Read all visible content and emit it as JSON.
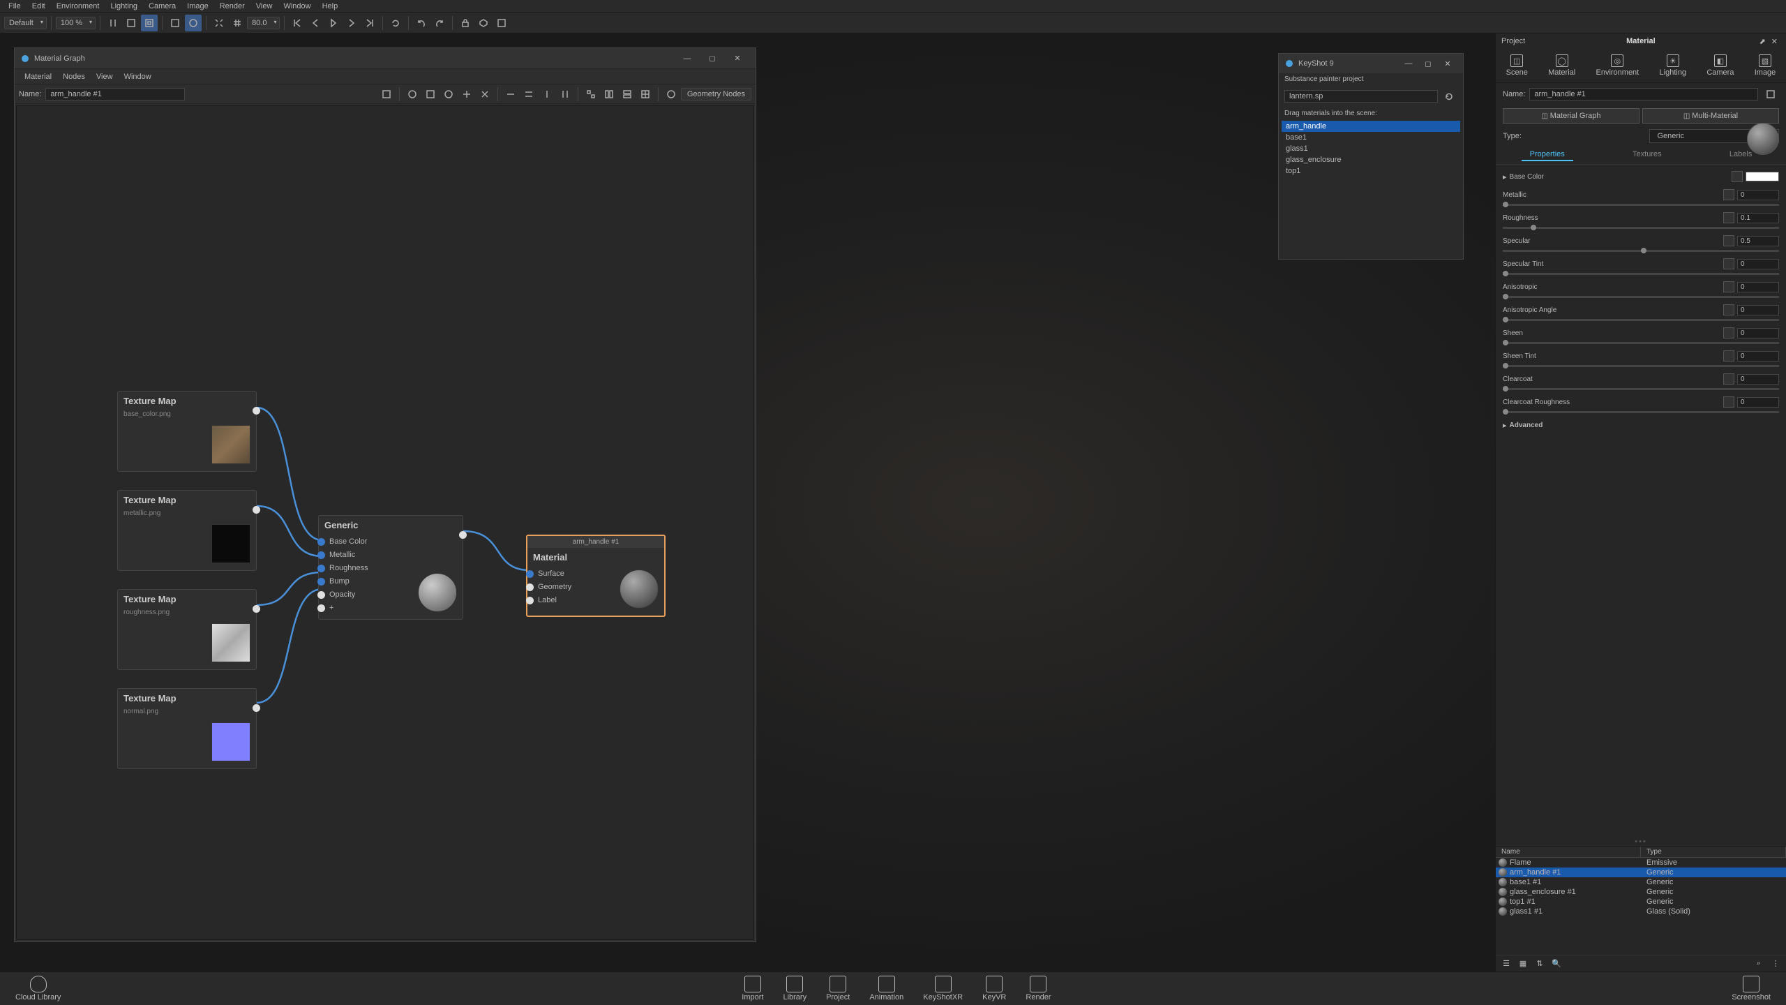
{
  "menubar": [
    "File",
    "Edit",
    "Environment",
    "Lighting",
    "Camera",
    "Image",
    "Render",
    "View",
    "Window",
    "Help"
  ],
  "toolbar": {
    "workspace": "Default",
    "zoom": "100 %",
    "frame": "80.0"
  },
  "materialGraph": {
    "title": "Material Graph",
    "menus": [
      "Material",
      "Nodes",
      "View",
      "Window"
    ],
    "nameLabel": "Name:",
    "nameValue": "arm_handle #1",
    "geomNodes": "Geometry Nodes",
    "nodes": {
      "tex1": {
        "title": "Texture Map",
        "file": "base_color.png"
      },
      "tex2": {
        "title": "Texture Map",
        "file": "metallic.png"
      },
      "tex3": {
        "title": "Texture Map",
        "file": "roughness.png"
      },
      "tex4": {
        "title": "Texture Map",
        "file": "normal.png"
      },
      "generic": {
        "title": "Generic",
        "ins": [
          "Base Color",
          "Metallic",
          "Roughness",
          "Bump",
          "Opacity",
          "+"
        ]
      },
      "material": {
        "name": "arm_handle #1",
        "title": "Material",
        "ins": [
          "Surface",
          "Geometry",
          "Label"
        ]
      }
    }
  },
  "ksPanel": {
    "title": "KeyShot 9",
    "sub": "Substance painter project",
    "file": "lantern.sp",
    "hint": "Drag materials into the scene:",
    "items": [
      "arm_handle",
      "base1",
      "glass1",
      "glass_enclosure",
      "top1"
    ]
  },
  "rpanel": {
    "headLeft": "Project",
    "headTitle": "Material",
    "tabs": [
      "Scene",
      "Material",
      "Environment",
      "Lighting",
      "Camera",
      "Image"
    ],
    "activeTab": 1,
    "nameLabel": "Name:",
    "nameValue": "arm_handle #1",
    "btn1": "Material Graph",
    "btn2": "Multi-Material",
    "typeLabel": "Type:",
    "typeValue": "Generic",
    "subtabs": [
      "Properties",
      "Textures",
      "Labels"
    ],
    "activeSub": 0,
    "props": [
      {
        "l": "Base Color",
        "v": "",
        "kind": "swatch",
        "color": "#ffffff",
        "expand": true
      },
      {
        "l": "Metallic",
        "v": "0",
        "slider": 0
      },
      {
        "l": "Roughness",
        "v": "0.1",
        "slider": 10
      },
      {
        "l": "Specular",
        "v": "0.5",
        "slider": 50
      },
      {
        "l": "Specular Tint",
        "v": "0",
        "slider": 0
      },
      {
        "l": "Anisotropic",
        "v": "0",
        "slider": 0
      },
      {
        "l": "Anisotropic Angle",
        "v": "0",
        "slider": 0
      },
      {
        "l": "Sheen",
        "v": "0",
        "slider": 0
      },
      {
        "l": "Sheen Tint",
        "v": "0",
        "slider": 0
      },
      {
        "l": "Clearcoat",
        "v": "0",
        "slider": 0
      },
      {
        "l": "Clearcoat Roughness",
        "v": "0",
        "slider": 0
      }
    ],
    "advanced": "Advanced",
    "listHead": [
      "Name",
      "Type"
    ],
    "list": [
      {
        "n": "Flame",
        "t": "Emissive"
      },
      {
        "n": "arm_handle #1",
        "t": "Generic",
        "sel": true
      },
      {
        "n": "base1 #1",
        "t": "Generic"
      },
      {
        "n": "glass_enclosure #1",
        "t": "Generic"
      },
      {
        "n": "top1 #1",
        "t": "Generic"
      },
      {
        "n": "glass1 #1",
        "t": "Glass (Solid)"
      }
    ]
  },
  "dock": {
    "left": "Cloud Library",
    "tabs": [
      "Import",
      "Library",
      "Project",
      "Animation",
      "KeyShotXR",
      "KeyVR",
      "Render"
    ],
    "activeTab": 2,
    "right": "Screenshot"
  }
}
